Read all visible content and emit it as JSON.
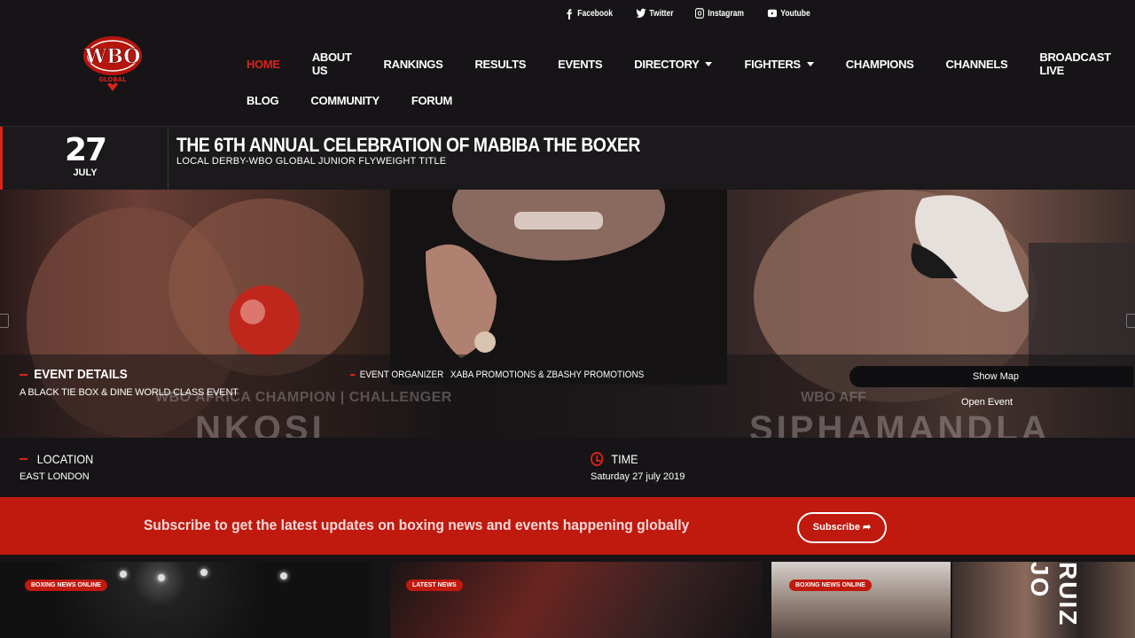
{
  "social": [
    {
      "label": "Facebook",
      "icon": "facebook-icon"
    },
    {
      "label": "Twitter",
      "icon": "twitter-icon"
    },
    {
      "label": "Instagram",
      "icon": "instagram-icon"
    },
    {
      "label": "Youtube",
      "icon": "youtube-icon"
    }
  ],
  "logo": {
    "text": "WBO",
    "subtext": "GLOBAL"
  },
  "nav": {
    "row1": [
      {
        "label": "HOME",
        "active": true
      },
      {
        "label": "ABOUT US"
      },
      {
        "label": "RANKINGS"
      },
      {
        "label": "RESULTS"
      },
      {
        "label": "EVENTS"
      },
      {
        "label": "DIRECTORY",
        "dropdown": true
      },
      {
        "label": "FIGHTERS",
        "dropdown": true
      },
      {
        "label": "CHAMPIONS"
      },
      {
        "label": "CHANNELS"
      },
      {
        "label": "BROADCAST LIVE"
      }
    ],
    "row2": [
      {
        "label": "BLOG"
      },
      {
        "label": "COMMUNITY"
      },
      {
        "label": "FORUM"
      }
    ]
  },
  "event": {
    "day": "27",
    "month": "JULY",
    "title": "THE 6TH ANNUAL CELEBRATION OF MABIBA THE BOXER",
    "subtitle": "LOCAL DERBY-WBO GLOBAL JUNIOR FLYWEIGHT TITLE",
    "details_title": "EVENT DETAILS",
    "details_desc": "A BLACK TIE BOX & DINE WORLD CLASS EVENT",
    "organizer_label": "EVENT ORGANIZER",
    "organizer_value": "XABA PROMOTIONS & ZBASHY PROMOTIONS",
    "show_map": "Show Map",
    "open_event": "Open Event",
    "overlay_left": "WBO AFRICA CHAMPION | CHALLENGER",
    "overlay_left_name": "NKOSI",
    "overlay_right": "WBO AFF",
    "overlay_right_name": "SIPHAMANDLA",
    "location_label": "LOCATION",
    "location_value": "EAST LONDON",
    "time_label": "TIME",
    "time_value": "Saturday 27 july 2019"
  },
  "subscribe": {
    "text": "Subscribe to get the latest updates on boxing news and events happening globally",
    "button": "Subscribe"
  },
  "cards": [
    {
      "badge": "BOXING NEWS ONLINE"
    },
    {
      "badge": "LATEST NEWS"
    },
    {
      "badge": "BOXING NEWS ONLINE"
    },
    {
      "overlay": "RUIZ JO"
    }
  ],
  "colors": {
    "accent": "#d8241b",
    "background": "#161417",
    "subscribe_bg": "#c0190e"
  }
}
